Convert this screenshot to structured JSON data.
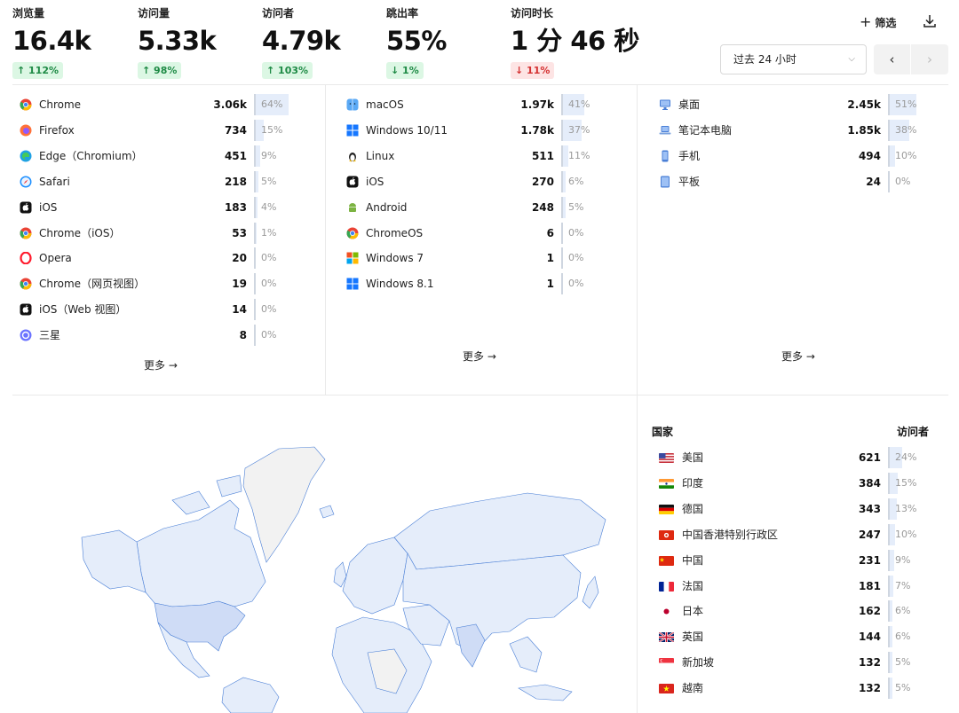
{
  "metrics": [
    {
      "label": "浏览量",
      "value": "16.4k",
      "change": "↑ 112%",
      "dir": "up"
    },
    {
      "label": "访问量",
      "value": "5.33k",
      "change": "↑ 98%",
      "dir": "up"
    },
    {
      "label": "访问者",
      "value": "4.79k",
      "change": "↑ 103%",
      "dir": "up"
    },
    {
      "label": "跳出率",
      "value": "55%",
      "change": "↓ 1%",
      "dir": "up"
    },
    {
      "label": "访问时长",
      "value": "1 分 46 秒",
      "change": "↓ 11%",
      "dir": "down"
    }
  ],
  "toolbar": {
    "filter_label": "筛选",
    "date_range": "过去 24 小时"
  },
  "browsers": {
    "more_label": "更多 →",
    "items": [
      {
        "label": "Chrome",
        "value": "3.06k",
        "pct": "64%",
        "share": 0.64,
        "icon": "chrome-icon"
      },
      {
        "label": "Firefox",
        "value": "734",
        "pct": "15%",
        "share": 0.15,
        "icon": "firefox-icon"
      },
      {
        "label": "Edge（Chromium）",
        "value": "451",
        "pct": "9%",
        "share": 0.09,
        "icon": "edge-icon"
      },
      {
        "label": "Safari",
        "value": "218",
        "pct": "5%",
        "share": 0.05,
        "icon": "safari-icon"
      },
      {
        "label": "iOS",
        "value": "183",
        "pct": "4%",
        "share": 0.04,
        "icon": "apple-icon"
      },
      {
        "label": "Chrome（iOS）",
        "value": "53",
        "pct": "1%",
        "share": 0.01,
        "icon": "chrome-icon"
      },
      {
        "label": "Opera",
        "value": "20",
        "pct": "0%",
        "share": 0,
        "icon": "opera-icon"
      },
      {
        "label": "Chrome（网页视图）",
        "value": "19",
        "pct": "0%",
        "share": 0,
        "icon": "chrome-icon"
      },
      {
        "label": "iOS（Web 视图）",
        "value": "14",
        "pct": "0%",
        "share": 0,
        "icon": "apple-icon"
      },
      {
        "label": "三星",
        "value": "8",
        "pct": "0%",
        "share": 0,
        "icon": "samsung-icon"
      }
    ]
  },
  "os": {
    "more_label": "更多 →",
    "items": [
      {
        "label": "macOS",
        "value": "1.97k",
        "pct": "41%",
        "share": 0.41,
        "icon": "macos-icon"
      },
      {
        "label": "Windows 10/11",
        "value": "1.78k",
        "pct": "37%",
        "share": 0.37,
        "icon": "windows-icon"
      },
      {
        "label": "Linux",
        "value": "511",
        "pct": "11%",
        "share": 0.11,
        "icon": "linux-icon"
      },
      {
        "label": "iOS",
        "value": "270",
        "pct": "6%",
        "share": 0.06,
        "icon": "apple-icon"
      },
      {
        "label": "Android",
        "value": "248",
        "pct": "5%",
        "share": 0.05,
        "icon": "android-icon"
      },
      {
        "label": "ChromeOS",
        "value": "6",
        "pct": "0%",
        "share": 0,
        "icon": "chrome-icon"
      },
      {
        "label": "Windows 7",
        "value": "1",
        "pct": "0%",
        "share": 0,
        "icon": "windows7-icon"
      },
      {
        "label": "Windows 8.1",
        "value": "1",
        "pct": "0%",
        "share": 0,
        "icon": "windows-icon"
      }
    ]
  },
  "devices": {
    "more_label": "更多 →",
    "items": [
      {
        "label": "桌面",
        "value": "2.45k",
        "pct": "51%",
        "share": 0.51,
        "icon": "desktop-icon"
      },
      {
        "label": "笔记本电脑",
        "value": "1.85k",
        "pct": "38%",
        "share": 0.38,
        "icon": "laptop-icon"
      },
      {
        "label": "手机",
        "value": "494",
        "pct": "10%",
        "share": 0.1,
        "icon": "phone-icon"
      },
      {
        "label": "平板",
        "value": "24",
        "pct": "0%",
        "share": 0,
        "icon": "tablet-icon"
      }
    ]
  },
  "countries": {
    "col_country": "国家",
    "col_visitors": "访问者",
    "items": [
      {
        "label": "美国",
        "value": "621",
        "pct": "24%",
        "share": 0.24,
        "icon": "flag-us-icon"
      },
      {
        "label": "印度",
        "value": "384",
        "pct": "15%",
        "share": 0.15,
        "icon": "flag-in-icon"
      },
      {
        "label": "德国",
        "value": "343",
        "pct": "13%",
        "share": 0.13,
        "icon": "flag-de-icon"
      },
      {
        "label": "中国香港特别行政区",
        "value": "247",
        "pct": "10%",
        "share": 0.1,
        "icon": "flag-hk-icon"
      },
      {
        "label": "中国",
        "value": "231",
        "pct": "9%",
        "share": 0.09,
        "icon": "flag-cn-icon"
      },
      {
        "label": "法国",
        "value": "181",
        "pct": "7%",
        "share": 0.07,
        "icon": "flag-fr-icon"
      },
      {
        "label": "日本",
        "value": "162",
        "pct": "6%",
        "share": 0.06,
        "icon": "flag-jp-icon"
      },
      {
        "label": "英国",
        "value": "144",
        "pct": "6%",
        "share": 0.06,
        "icon": "flag-gb-icon"
      },
      {
        "label": "新加坡",
        "value": "132",
        "pct": "5%",
        "share": 0.05,
        "icon": "flag-sg-icon"
      },
      {
        "label": "越南",
        "value": "132",
        "pct": "5%",
        "share": 0.05,
        "icon": "flag-vn-icon"
      }
    ]
  },
  "colors": {
    "up_bg": "#dcf7e4",
    "up_fg": "#1e8a45",
    "down_bg": "#fde4e4",
    "down_fg": "#d43030",
    "bar": "#e5edfa",
    "map_land": "#e5edfa",
    "map_empty": "#f2f2f2",
    "map_stroke": "#4a7fd6"
  }
}
